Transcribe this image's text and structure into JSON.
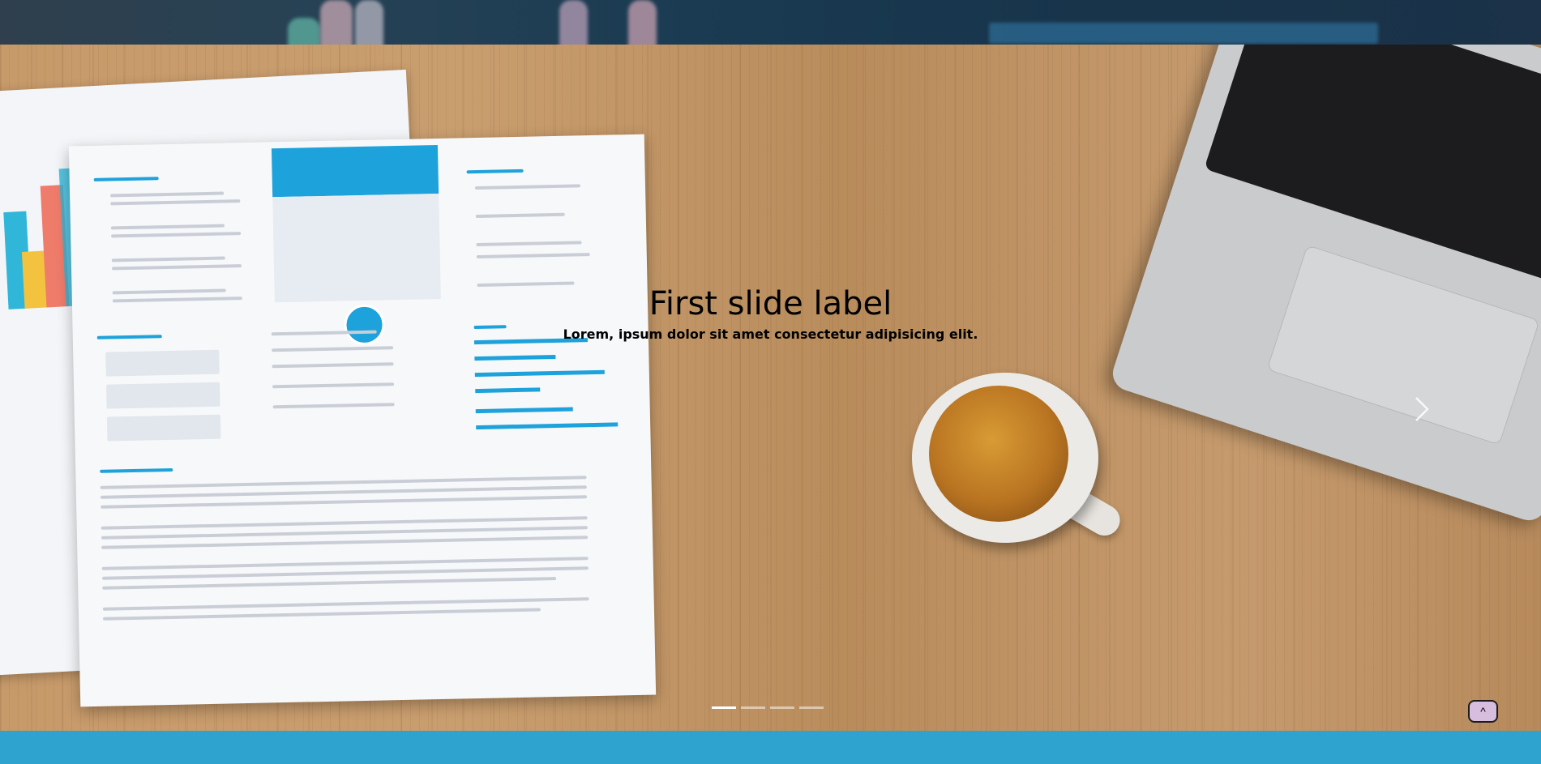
{
  "carousel": {
    "slides": [
      {
        "label": "First slide label",
        "text": "Lorem, ipsum dolor sit amet consectetur adipisicing elit."
      }
    ],
    "active_index": 0,
    "indicator_count": 4,
    "next_icon": "chevron-right-icon"
  },
  "back_to_top": {
    "label": "^",
    "icon": "caret-up-icon"
  },
  "colors": {
    "footer": "#2ea3d0",
    "back_to_top_bg": "#d7bedf",
    "resume_accent": "#1ea2dc"
  }
}
